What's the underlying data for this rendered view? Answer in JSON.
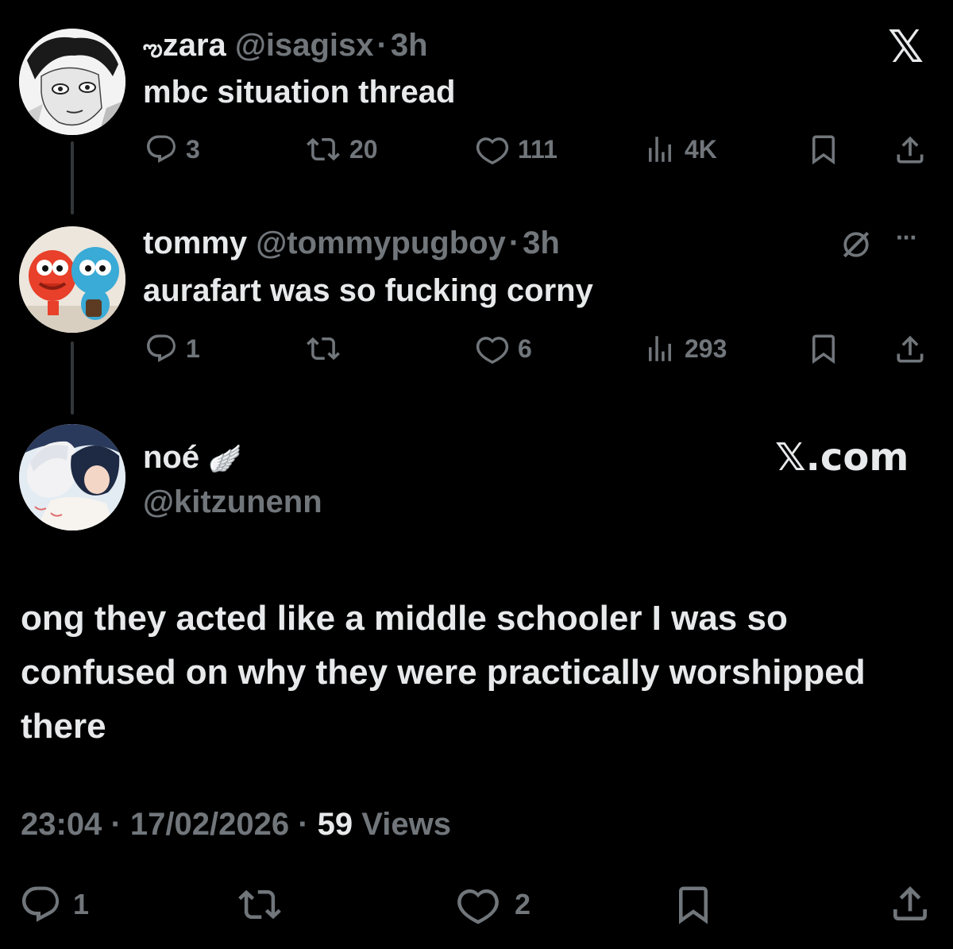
{
  "posts": [
    {
      "display_name": "zara",
      "name_prefix_glyph": "ఌ",
      "handle": "@isagisx",
      "separator": "·",
      "time": "3h",
      "text": "mbc situation thread",
      "actions": {
        "replies": "3",
        "reposts": "20",
        "likes": "111",
        "views": "4K"
      }
    },
    {
      "display_name": "tommy",
      "handle": "@tommypugboy",
      "separator": "·",
      "time": "3h",
      "text": "aurafart was so fucking corny",
      "actions": {
        "replies": "1",
        "reposts": "",
        "likes": "6",
        "views": "293"
      },
      "more_icon": "···"
    }
  ],
  "main_post": {
    "display_name": "noé",
    "badge_emoji": "🪽",
    "handle": "@kitzunenn",
    "text": "ong they acted like a middle schooler I was so confused on why they were practically worshipped there",
    "time": "23:04",
    "date": "17/02/2026",
    "separator": "·",
    "views_count": "59",
    "views_label": "Views",
    "actions": {
      "replies": "1",
      "reposts": "",
      "likes": "2"
    }
  },
  "brand": {
    "top_logo": "𝕏",
    "watermark": "𝕏.com"
  },
  "colors": {
    "background": "#000000",
    "text_primary": "#e7e9ea",
    "text_muted": "#71767b",
    "thread_line": "#333639"
  },
  "icons": [
    "reply-icon",
    "repost-icon",
    "like-icon",
    "views-icon",
    "bookmark-icon",
    "share-icon",
    "grok-icon",
    "more-icon"
  ]
}
